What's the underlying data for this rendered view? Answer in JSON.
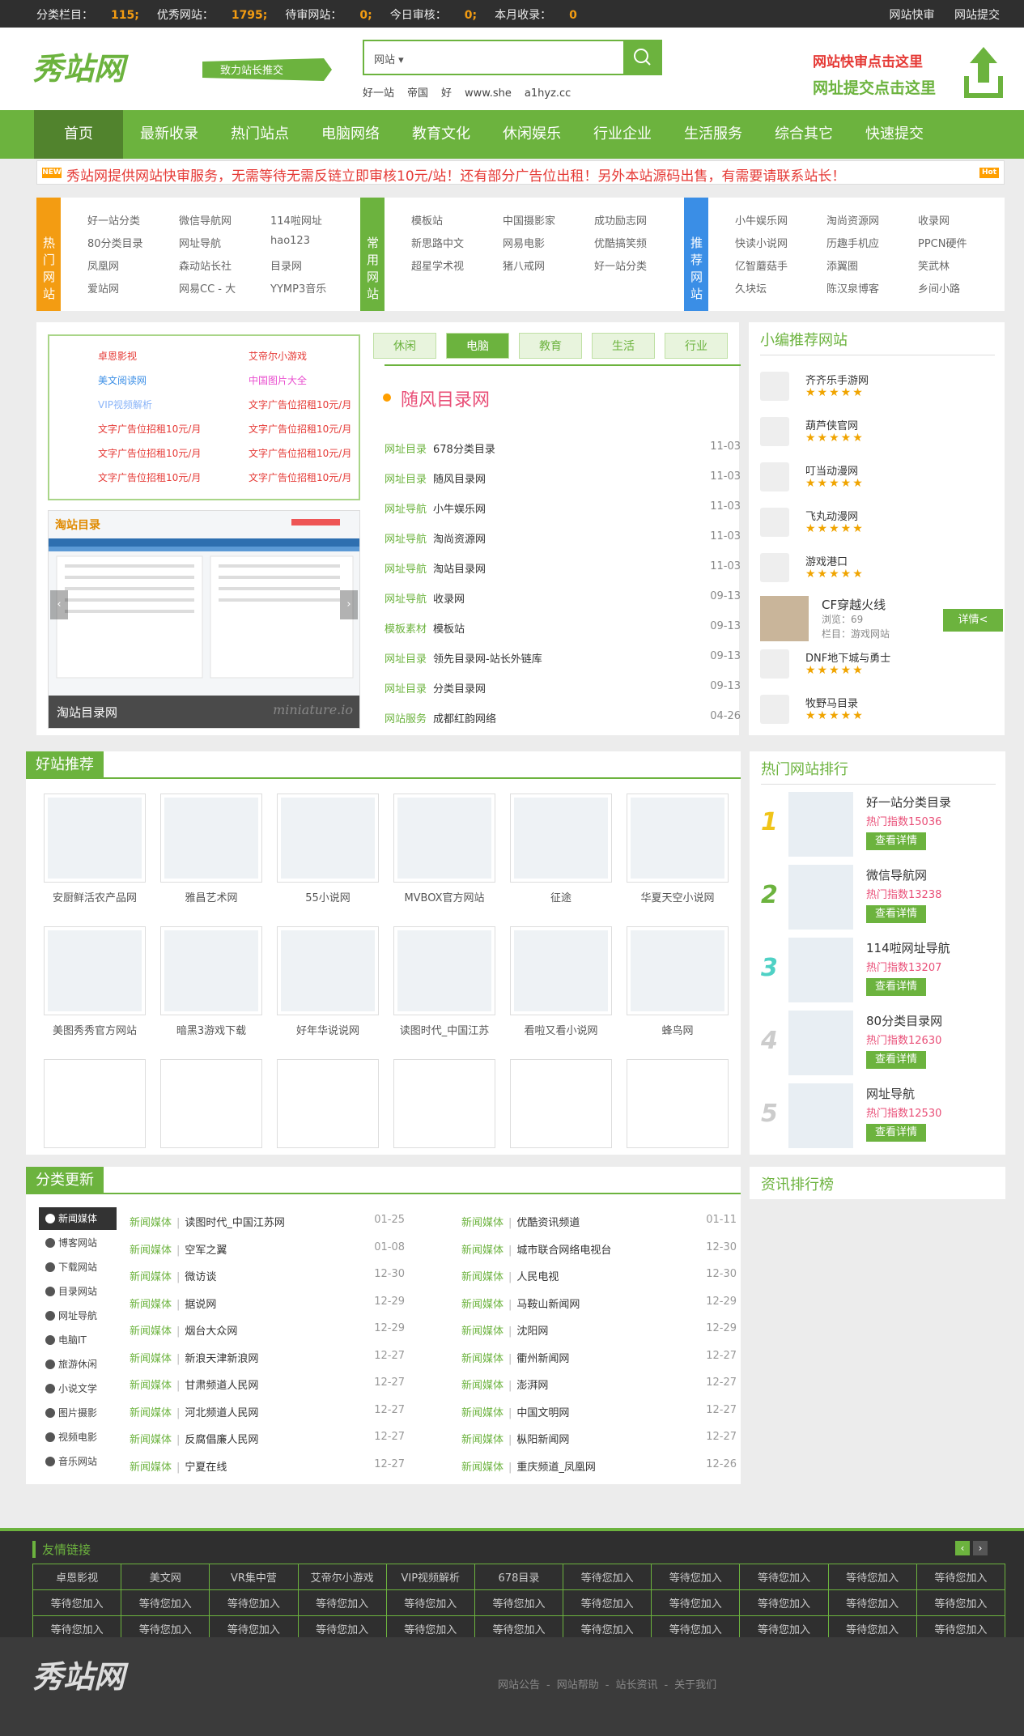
{
  "topbar": {
    "stats": [
      {
        "label": "分类栏目：",
        "value": "115;"
      },
      {
        "label": "优秀网站：",
        "value": "1795;"
      },
      {
        "label": "待审网站：",
        "value": "0;"
      },
      {
        "label": "今日审核：",
        "value": "0;"
      },
      {
        "label": "本月收录：",
        "value": "0"
      }
    ],
    "links": [
      "网站快审",
      "网站提交"
    ]
  },
  "header": {
    "logo": "秀站网",
    "slogan": "致力站长推交",
    "search_select": "网站",
    "hot_words": [
      "好一站",
      "帝国",
      "好",
      "www.she",
      "a1hyz.cc"
    ],
    "right_line1": "网站快审点击这里",
    "right_line2": "网址提交点击这里"
  },
  "nav": [
    "首页",
    "最新收录",
    "热门站点",
    "电脑网络",
    "教育文化",
    "休闲娱乐",
    "行业企业",
    "生活服务",
    "综合其它",
    "快速提交"
  ],
  "notice": {
    "new_badge": "NEW",
    "text": "秀站网提供网站快审服务，无需等待无需反链立即审核10元/站！还有部分广告位出租！另外本站源码出售，有需要请联系站长！",
    "hot_badge": "Hot"
  },
  "quick": [
    {
      "label": "热门网站",
      "links": [
        "好一站分类",
        "微信导航网",
        "114啦网址",
        "80分类目录",
        "网址导航",
        "hao123",
        "凤凰网",
        "森动站长社",
        "目录网",
        "爱站网",
        "网易CC - 大",
        "YYMP3音乐"
      ]
    },
    {
      "label": "常用网站",
      "links": [
        "模板站",
        "中国摄影家",
        "成功励志网",
        "新思路中文",
        "网易电影",
        "优酷搞笑频",
        "超星学术视",
        "猪八戒网",
        "好一站分类"
      ]
    },
    {
      "label": "推荐网站",
      "links": [
        "小牛娱乐网",
        "淘尚资源网",
        "收录网",
        "快读小说网",
        "历趣手机应",
        "PPCN硬件",
        "亿智蘑菇手",
        "添翼圈",
        "笑武林",
        "久块坛",
        "陈汉泉博客",
        "乡间小路"
      ]
    }
  ],
  "ads": [
    "卓恩影视",
    "艾帝尔小游戏",
    "美文阅读网",
    "中国图片大全",
    "VIP视频解析",
    "文字广告位招租10元/月",
    "文字广告位招租10元/月",
    "文字广告位招租10元/月",
    "文字广告位招租10元/月",
    "文字广告位招租10元/月",
    "文字广告位招租10元/月",
    "文字广告位招租10元/月"
  ],
  "slide_caption": "淘站目录网",
  "slide_watermark": "miniature.io",
  "tabs": [
    "休闲",
    "电脑",
    "教育",
    "生活",
    "行业"
  ],
  "feature_title": "随风目录网",
  "latest": [
    {
      "cat": "网址目录",
      "name": "678分类目录",
      "date": "11-03"
    },
    {
      "cat": "网址目录",
      "name": "随风目录网",
      "date": "11-03"
    },
    {
      "cat": "网址导航",
      "name": "小牛娱乐网",
      "date": "11-03"
    },
    {
      "cat": "网址导航",
      "name": "淘尚资源网",
      "date": "11-03"
    },
    {
      "cat": "网址导航",
      "name": "淘站目录网",
      "date": "11-03"
    },
    {
      "cat": "网址导航",
      "name": "收录网",
      "date": "09-13"
    },
    {
      "cat": "模板素材",
      "name": "模板站",
      "date": "09-13"
    },
    {
      "cat": "网址目录",
      "name": "领先目录网-站长外链库",
      "date": "09-13"
    },
    {
      "cat": "网址目录",
      "name": "分类目录网",
      "date": "09-13"
    },
    {
      "cat": "网站服务",
      "name": "成都红韵网络",
      "date": "04-26"
    }
  ],
  "editor": {
    "title": "小编推荐网站",
    "items": [
      "齐齐乐手游网",
      "葫芦侠官网",
      "叮当动漫网",
      "飞丸动漫网",
      "游戏港口",
      "DNF地下城与勇士",
      "牧野马目录"
    ],
    "stars": "★★★★★",
    "featured": {
      "name": "CF穿越火线",
      "views": "浏览：69",
      "column": "栏目：游戏网站",
      "button": "详情<"
    }
  },
  "good": {
    "title": "好站推荐",
    "items": [
      "安厨鲜活农产品网",
      "雅昌艺术网",
      "55小说网",
      "MVBOX官方网站",
      "征途",
      "华夏天空小说网",
      "美图秀秀官方网站",
      "暗黑3游戏下载",
      "好年华说说网",
      "读图时代_中国江苏",
      "看啦又看小说网",
      "蜂鸟网"
    ]
  },
  "rank": {
    "title": "热门网站排行",
    "items": [
      {
        "no": "1",
        "name": "好一站分类目录",
        "hot": "热门指数15036",
        "color": "#f0c419"
      },
      {
        "no": "2",
        "name": "微信导航网",
        "hot": "热门指数13238",
        "color": "#6cb33e"
      },
      {
        "no": "3",
        "name": "114啦网址导航",
        "hot": "热门指数13207",
        "color": "#4fd1c5"
      },
      {
        "no": "4",
        "name": "80分类目录网",
        "hot": "热门指数12630",
        "color": "#cccccc"
      },
      {
        "no": "5",
        "name": "网址导航",
        "hot": "热门指数12530",
        "color": "#cccccc"
      }
    ],
    "button": "查看详情"
  },
  "news_rank_title": "资讯排行榜",
  "updates": {
    "title": "分类更新",
    "cats": [
      "新闻媒体",
      "博客网站",
      "下载网站",
      "目录网站",
      "网址导航",
      "电脑IT",
      "旅游休闲",
      "小说文学",
      "图片摄影",
      "视频电影",
      "音乐网站"
    ],
    "left": [
      {
        "cat": "新闻媒体",
        "name": "读图时代_中国江苏网",
        "date": "01-25"
      },
      {
        "cat": "新闻媒体",
        "name": "空军之翼",
        "date": "01-08"
      },
      {
        "cat": "新闻媒体",
        "name": "微访谈",
        "date": "12-30"
      },
      {
        "cat": "新闻媒体",
        "name": "据说网",
        "date": "12-29"
      },
      {
        "cat": "新闻媒体",
        "name": "烟台大众网",
        "date": "12-29"
      },
      {
        "cat": "新闻媒体",
        "name": "新浪天津新浪网",
        "date": "12-27"
      },
      {
        "cat": "新闻媒体",
        "name": "甘肃频道人民网",
        "date": "12-27"
      },
      {
        "cat": "新闻媒体",
        "name": "河北频道人民网",
        "date": "12-27"
      },
      {
        "cat": "新闻媒体",
        "name": "反腐倡廉人民网",
        "date": "12-27"
      },
      {
        "cat": "新闻媒体",
        "name": "宁夏在线",
        "date": "12-27"
      }
    ],
    "right": [
      {
        "cat": "新闻媒体",
        "name": "优酷资讯频道",
        "date": "01-11"
      },
      {
        "cat": "新闻媒体",
        "name": "城市联合网络电视台",
        "date": "12-30"
      },
      {
        "cat": "新闻媒体",
        "name": "人民电视",
        "date": "12-30"
      },
      {
        "cat": "新闻媒体",
        "name": "马鞍山新闻网",
        "date": "12-29"
      },
      {
        "cat": "新闻媒体",
        "name": "沈阳网",
        "date": "12-29"
      },
      {
        "cat": "新闻媒体",
        "name": "衢州新闻网",
        "date": "12-27"
      },
      {
        "cat": "新闻媒体",
        "name": "澎湃网",
        "date": "12-27"
      },
      {
        "cat": "新闻媒体",
        "name": "中国文明网",
        "date": "12-27"
      },
      {
        "cat": "新闻媒体",
        "name": "枞阳新闻网",
        "date": "12-27"
      },
      {
        "cat": "新闻媒体",
        "name": "重庆频道_凤凰网",
        "date": "12-26"
      }
    ]
  },
  "friends": {
    "title": "友情链接",
    "rows": [
      [
        "卓恩影视",
        "美文网",
        "VR集中营",
        "艾帝尔小游戏",
        "VIP视频解析",
        "678目录",
        "等待您加入",
        "等待您加入",
        "等待您加入",
        "等待您加入",
        "等待您加入"
      ],
      [
        "等待您加入",
        "等待您加入",
        "等待您加入",
        "等待您加入",
        "等待您加入",
        "等待您加入",
        "等待您加入",
        "等待您加入",
        "等待您加入",
        "等待您加入",
        "等待您加入"
      ],
      [
        "等待您加入",
        "等待您加入",
        "等待您加入",
        "等待您加入",
        "等待您加入",
        "等待您加入",
        "等待您加入",
        "等待您加入",
        "等待您加入",
        "等待您加入",
        "等待您加入"
      ]
    ]
  },
  "footer": {
    "logo": "秀站网",
    "links": [
      "网站公告",
      "网站帮助",
      "站长资讯",
      "关于我们"
    ],
    "sep": "-"
  },
  "colors": {
    "accent": "#6cb33e",
    "dark": "#2f2f2f",
    "red": "#e53935"
  },
  "icons": [
    "search-icon",
    "arrow-up-icon",
    "arrow-left-icon",
    "arrow-right-icon",
    "fire-icon",
    "grid-icon",
    "crown-icon"
  ]
}
